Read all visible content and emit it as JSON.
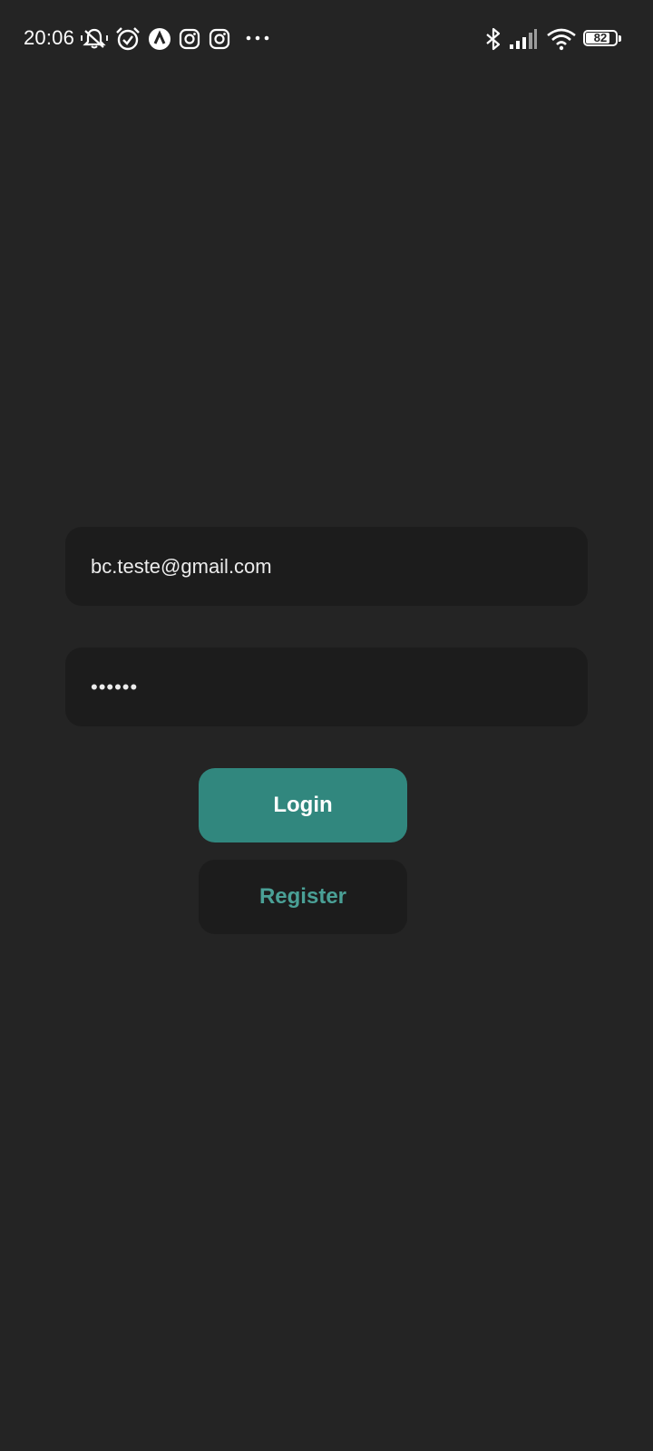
{
  "status_bar": {
    "time": "20:06",
    "battery_level": "82",
    "icons": [
      "muted-vibrate-icon",
      "alarm-icon",
      "app-arrow-icon",
      "instagram-icon",
      "instagram-icon",
      "more-dots-icon",
      "bluetooth-icon",
      "signal-icon",
      "wifi-icon",
      "battery-icon"
    ]
  },
  "login_form": {
    "email_value": "bc.teste@gmail.com",
    "password_value": "••••••",
    "login_label": "Login",
    "register_label": "Register"
  },
  "colors": {
    "background": "#242424",
    "field_background": "#1c1c1c",
    "accent": "#31877e",
    "register_text": "#4aa096"
  }
}
